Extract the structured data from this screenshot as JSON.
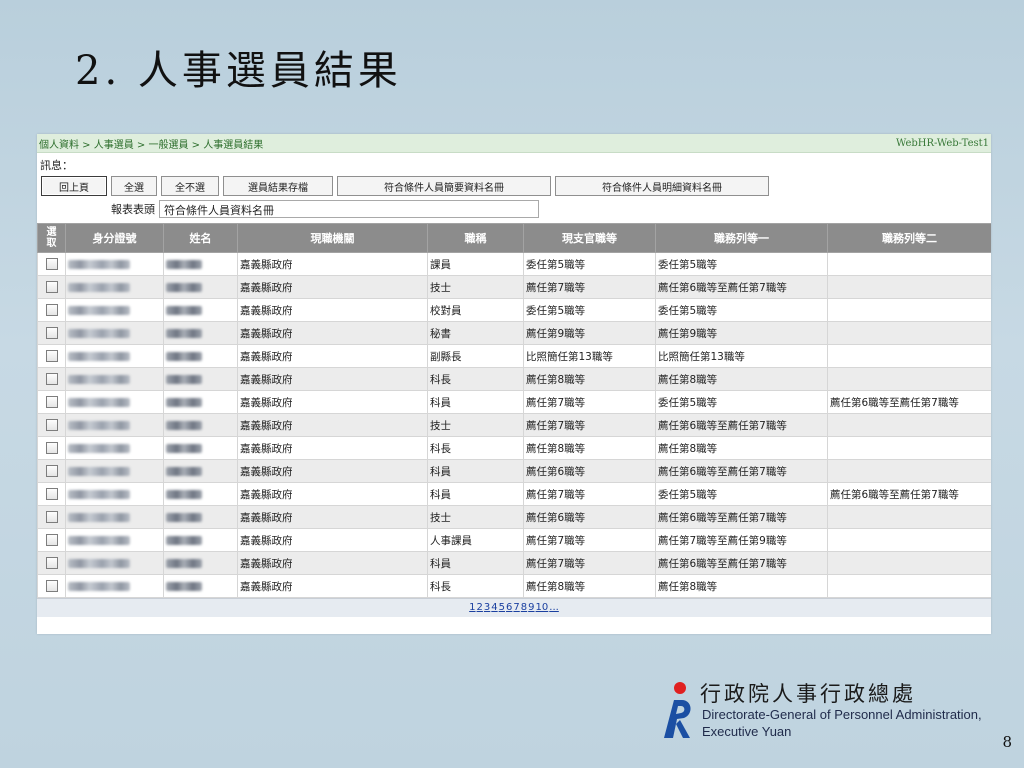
{
  "slide": {
    "title": "2. 人事選員結果",
    "page_number": "8"
  },
  "app": {
    "breadcrumb": "個人資料 > 人事選員 > 一般選員 > 人事選員結果",
    "system_name": "WebHR-Web-Test1",
    "message_label": "訊息："
  },
  "toolbar": {
    "buttons": [
      "回上頁",
      "全選",
      "全不選",
      "選員結果存檔",
      "符合條件人員簡要資料名冊",
      "符合條件人員明細資料名冊"
    ]
  },
  "report_header": {
    "label": "報表表頭",
    "value": "符合條件人員資料名冊"
  },
  "table": {
    "columns": [
      "選取",
      "身分證號",
      "姓名",
      "現職機關",
      "職稱",
      "現支官職等",
      "職務列等一",
      "職務列等二"
    ],
    "rows": [
      {
        "org": "嘉義縣政府",
        "title": "課員",
        "grade": "委任第5職等",
        "rank1": "委任第5職等",
        "rank2": ""
      },
      {
        "org": "嘉義縣政府",
        "title": "技士",
        "grade": "薦任第7職等",
        "rank1": "薦任第6職等至薦任第7職等",
        "rank2": ""
      },
      {
        "org": "嘉義縣政府",
        "title": "校對員",
        "grade": "委任第5職等",
        "rank1": "委任第5職等",
        "rank2": ""
      },
      {
        "org": "嘉義縣政府",
        "title": "秘書",
        "grade": "薦任第9職等",
        "rank1": "薦任第9職等",
        "rank2": ""
      },
      {
        "org": "嘉義縣政府",
        "title": "副縣長",
        "grade": "比照簡任第13職等",
        "rank1": "比照簡任第13職等",
        "rank2": ""
      },
      {
        "org": "嘉義縣政府",
        "title": "科長",
        "grade": "薦任第8職等",
        "rank1": "薦任第8職等",
        "rank2": ""
      },
      {
        "org": "嘉義縣政府",
        "title": "科員",
        "grade": "薦任第7職等",
        "rank1": "委任第5職等",
        "rank2": "薦任第6職等至薦任第7職等"
      },
      {
        "org": "嘉義縣政府",
        "title": "技士",
        "grade": "薦任第7職等",
        "rank1": "薦任第6職等至薦任第7職等",
        "rank2": ""
      },
      {
        "org": "嘉義縣政府",
        "title": "科長",
        "grade": "薦任第8職等",
        "rank1": "薦任第8職等",
        "rank2": ""
      },
      {
        "org": "嘉義縣政府",
        "title": "科員",
        "grade": "薦任第6職等",
        "rank1": "薦任第6職等至薦任第7職等",
        "rank2": ""
      },
      {
        "org": "嘉義縣政府",
        "title": "科員",
        "grade": "薦任第7職等",
        "rank1": "委任第5職等",
        "rank2": "薦任第6職等至薦任第7職等"
      },
      {
        "org": "嘉義縣政府",
        "title": "技士",
        "grade": "薦任第6職等",
        "rank1": "薦任第6職等至薦任第7職等",
        "rank2": ""
      },
      {
        "org": "嘉義縣政府",
        "title": "人事課員",
        "grade": "薦任第7職等",
        "rank1": "薦任第7職等至薦任第9職等",
        "rank2": ""
      },
      {
        "org": "嘉義縣政府",
        "title": "科員",
        "grade": "薦任第7職等",
        "rank1": "薦任第6職等至薦任第7職等",
        "rank2": ""
      },
      {
        "org": "嘉義縣政府",
        "title": "科長",
        "grade": "薦任第8職等",
        "rank1": "薦任第8職等",
        "rank2": ""
      }
    ]
  },
  "pager": {
    "pages": [
      "1",
      "2",
      "3",
      "4",
      "5",
      "6",
      "7",
      "8",
      "9",
      "10",
      "..."
    ]
  },
  "logo": {
    "zh": "行政院人事行政總處",
    "en_line1": "Directorate-General of Personnel Administration,",
    "en_line2": "Executive Yuan",
    "colors": {
      "red": "#e02020",
      "blue": "#1b4fa3"
    }
  }
}
